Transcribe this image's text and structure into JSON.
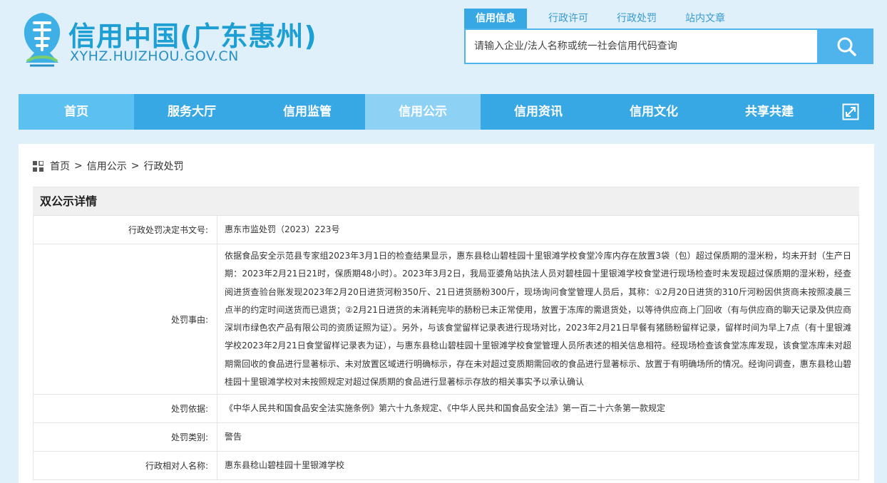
{
  "header": {
    "title": "信用中国(广东惠州)",
    "subtitle": "XYHZ.HUIZHOU.GOV.CN"
  },
  "search": {
    "tabs": [
      {
        "label": "信用信息",
        "active": true
      },
      {
        "label": "行政许可",
        "active": false
      },
      {
        "label": "行政处罚",
        "active": false
      },
      {
        "label": "站内文章",
        "active": false
      }
    ],
    "placeholder": "请输入企业/法人名称或统一社会信用代码查询",
    "button_icon": "search-icon"
  },
  "nav": {
    "items": [
      {
        "label": "首页"
      },
      {
        "label": "服务大厅"
      },
      {
        "label": "信用监管"
      },
      {
        "label": "信用公示"
      },
      {
        "label": "信用资讯"
      },
      {
        "label": "信用文化"
      },
      {
        "label": "共享共建"
      }
    ],
    "active_index": 3,
    "expand_icon": "expand-icon"
  },
  "breadcrumb": {
    "items": [
      "首页",
      "信用公示",
      "行政处罚"
    ],
    "separator": ">"
  },
  "panel": {
    "title": "双公示详情"
  },
  "details": [
    {
      "label": "行政处罚决定书文号:",
      "value": "惠东市监处罚（2023）223号"
    },
    {
      "label": "处罚事由:",
      "value": "依据食品安全示范县专家组2023年3月1日的检查结果显示，惠东县稔山碧桂园十里银滩学校食堂冷库内存在放置3袋（包）超过保质期的湿米粉，均未开封（生产日期：2023年2月21日21时，保质期48小时）。2023年3月2日，我局亚婆角站执法人员对碧桂园十里银滩学校食堂进行现场检查时未发现超过保质期的湿米粉，经查阅进货查验台账发现2023年2月20日进货河粉350斤、21日进货肠粉300斤，现场询问食堂管理人员后，其称：①2月20日进货的310斤河粉因供货商未按照凌晨三点半的约定时间送货而已退货；②2月21日进货的未消耗完毕的肠粉已未正常使用，放置于冻库的需退货处，以等待供应商上门回收（有与供应商的聊天记录及供应商深圳市绿色农产品有限公司的资质证照为证）。另外，与该食堂留样记录表进行现场对比，2023年2月21日早餐有猪肠粉留样记录，留样时间为早上7点（有十里银滩学校2023年2月21日食堂留样记录表为证），与惠东县稔山碧桂园十里银滩学校食堂管理人员所表述的相关信息相符。经现场检查该食堂冻库发现，该食堂冻库未对超期需回收的食品进行显著标示、未对放置区域进行明确标示，存在未对超过变质期需回收的食品进行显著标示、放置于有明确场所的情况。经询问调查，惠东县稔山碧桂园十里银滩学校对未按照规定对超过保质期的食品进行显著标示存放的相关事实予以承认确认"
    },
    {
      "label": "处罚依据:",
      "value": "《中华人民共和国食品安全法实施条例》第六十九条规定、《中华人民共和国食品安全法》第一百二十六条第一款规定"
    },
    {
      "label": "处罚类别:",
      "value": "警告"
    },
    {
      "label": "行政相对人名称:",
      "value": "惠东县稔山碧桂园十里银滩学校"
    }
  ],
  "colors": {
    "page_background": "#dff0fb",
    "brand_blue": "#37a8e3",
    "nav_active": "#8dd2f5",
    "logo_text": "#1e9fd4"
  }
}
